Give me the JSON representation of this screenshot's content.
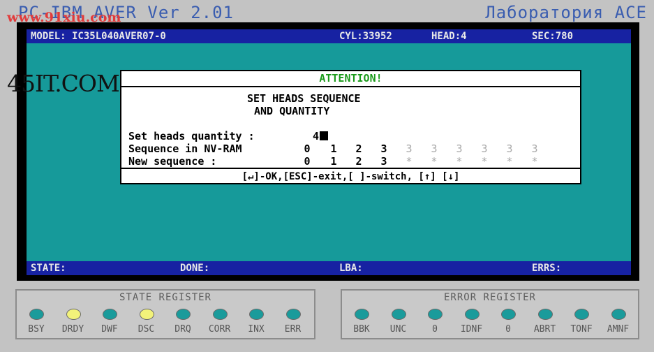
{
  "app": {
    "title": "PC-IBM AVER Ver 2.01",
    "lab": "Лаборатория ACE"
  },
  "watermark": {
    "url": "www.91xiu.com",
    "site": "45IT.COM"
  },
  "status_top": {
    "model": "MODEL: IC35L040AVER07-0",
    "cyl": "CYL:33952",
    "head": "HEAD:4",
    "sec": "SEC:780"
  },
  "status_bottom": {
    "state": "STATE:",
    "done": "DONE:",
    "lba": "LBA:",
    "errs": "ERRS:"
  },
  "dialog": {
    "title": "ATTENTION!",
    "heading_line1": "SET HEADS SEQUENCE",
    "heading_line2": "AND QUANTITY",
    "quantity_label": "Set heads quantity :",
    "quantity_value": "4",
    "nvram_label": "Sequence in NV-RAM",
    "new_label": "New sequence      :",
    "nvram_sequence": [
      "0",
      "1",
      "2",
      "3",
      "3",
      "3",
      "3",
      "3",
      "3",
      "3"
    ],
    "new_sequence": [
      "0",
      "1",
      "2",
      "3",
      "*",
      "*",
      "*",
      "*",
      "*",
      "*"
    ],
    "active_count": 4,
    "footer": "[↵]-OK,[ESC]-exit,[ ]-switch, [↑] [↓]"
  },
  "state_register": {
    "title": "STATE REGISTER",
    "leds": [
      {
        "label": "BSY",
        "color": "#1a9b9b"
      },
      {
        "label": "DRDY",
        "color": "#f2f27a"
      },
      {
        "label": "DWF",
        "color": "#1a9b9b"
      },
      {
        "label": "DSC",
        "color": "#f2f27a"
      },
      {
        "label": "DRQ",
        "color": "#1a9b9b"
      },
      {
        "label": "CORR",
        "color": "#1a9b9b"
      },
      {
        "label": "INX",
        "color": "#1a9b9b"
      },
      {
        "label": "ERR",
        "color": "#1a9b9b"
      }
    ]
  },
  "error_register": {
    "title": "ERROR REGISTER",
    "leds": [
      {
        "label": "BBK",
        "color": "#1a9b9b"
      },
      {
        "label": "UNC",
        "color": "#1a9b9b"
      },
      {
        "label": "0",
        "color": "#1a9b9b"
      },
      {
        "label": "IDNF",
        "color": "#1a9b9b"
      },
      {
        "label": "0",
        "color": "#1a9b9b"
      },
      {
        "label": "ABRT",
        "color": "#1a9b9b"
      },
      {
        "label": "TONF",
        "color": "#1a9b9b"
      },
      {
        "label": "AMNF",
        "color": "#1a9b9b"
      }
    ]
  }
}
